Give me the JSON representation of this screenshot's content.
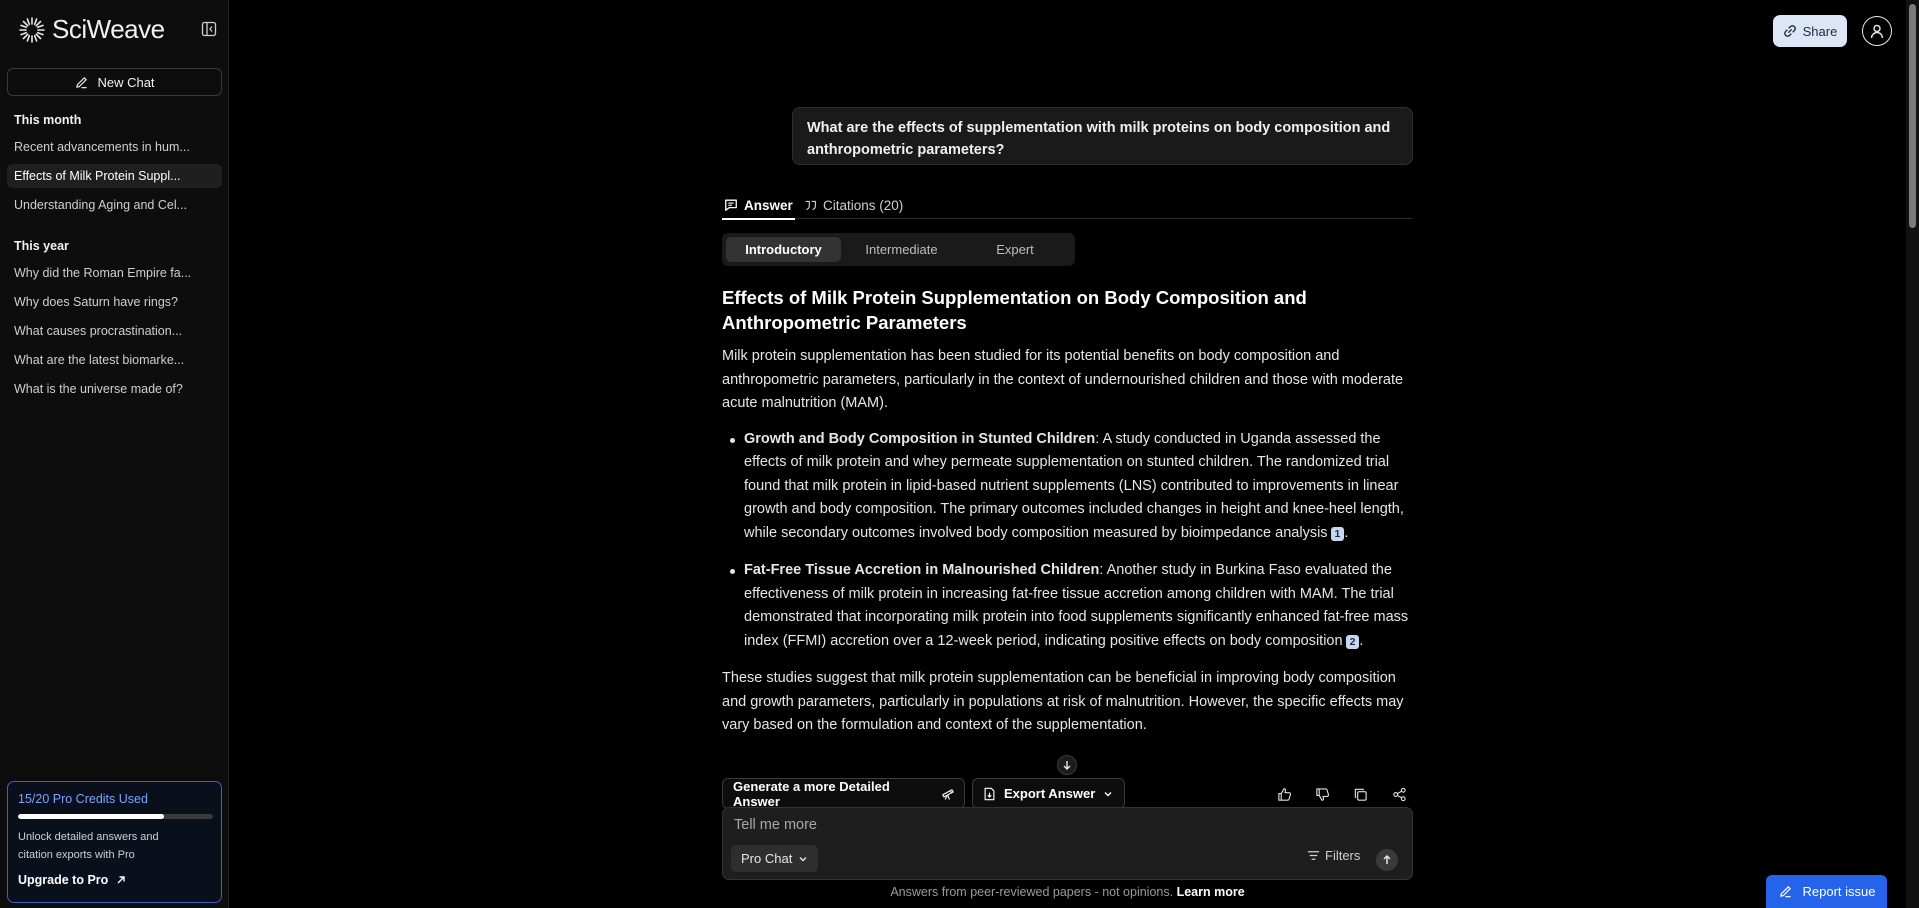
{
  "app": {
    "name": "SciWeave"
  },
  "sidebar": {
    "new_chat_label": "New Chat",
    "sections": [
      {
        "title": "This month",
        "items": [
          {
            "label": "Recent advancements in hum..."
          },
          {
            "label": "Effects of Milk Protein Suppl...",
            "active": true
          },
          {
            "label": "Understanding Aging and Cel..."
          }
        ]
      },
      {
        "title": "This year",
        "items": [
          {
            "label": "Why did the Roman Empire fa..."
          },
          {
            "label": "Why does Saturn have rings?"
          },
          {
            "label": "What causes procrastination..."
          },
          {
            "label": "What are the latest biomarke..."
          },
          {
            "label": "What is the universe made of?"
          }
        ]
      }
    ],
    "pro": {
      "title": "15/20 Pro Credits Used",
      "used": 15,
      "total": 20,
      "description": "Unlock detailed answers and citation exports with Pro",
      "upgrade_label": "Upgrade to Pro"
    }
  },
  "header": {
    "share_label": "Share"
  },
  "question": "What are the effects of supplementation with milk proteins on body composition and anthropometric parameters?",
  "tabs": {
    "answer": "Answer",
    "citations": "Citations (20)"
  },
  "levels": [
    "Introductory",
    "Intermediate",
    "Expert"
  ],
  "answer": {
    "title": "Effects of Milk Protein Supplementation on Body Composition and Anthropometric Parameters",
    "intro": "Milk protein supplementation has been studied for its potential benefits on body composition and anthropometric parameters, particularly in the context of undernourished children and those with moderate acute malnutrition (MAM).",
    "points": [
      {
        "heading": "Growth and Body Composition in Stunted Children",
        "text": ": A study conducted in Uganda assessed the effects of milk protein and whey permeate supplementation on stunted children. The randomized trial found that milk protein in lipid-based nutrient supplements (LNS) contributed to improvements in linear growth and body composition. The primary outcomes included changes in height and knee-heel length, while secondary outcomes involved body composition measured by bioimpedance analysis",
        "citation": "1"
      },
      {
        "heading": "Fat-Free Tissue Accretion in Malnourished Children",
        "text": ": Another study in Burkina Faso evaluated the effectiveness of milk protein in increasing fat-free tissue accretion among children with MAM. The trial demonstrated that incorporating milk protein into food supplements significantly enhanced fat-free mass index (FFMI) accretion over a 12-week period, indicating positive effects on body composition",
        "citation": "2"
      }
    ],
    "conclusion": "These studies suggest that milk protein supplementation can be beneficial in improving body composition and growth parameters, particularly in populations at risk of malnutrition. However, the specific effects may vary based on the formulation and context of the supplementation."
  },
  "actions": {
    "detailed_label": "Generate a more Detailed Answer",
    "export_label": "Export Answer"
  },
  "composer": {
    "placeholder": "Tell me more",
    "mode_label": "Pro Chat",
    "filters_label": "Filters"
  },
  "footer": {
    "note": "Answers from peer-reviewed papers - not opinions.",
    "link": "Learn more"
  },
  "report_label": "Report issue",
  "colors": {
    "accent": "#2563eb",
    "pro_border": "#3b62c9",
    "pro_text": "#7aa5ff"
  }
}
